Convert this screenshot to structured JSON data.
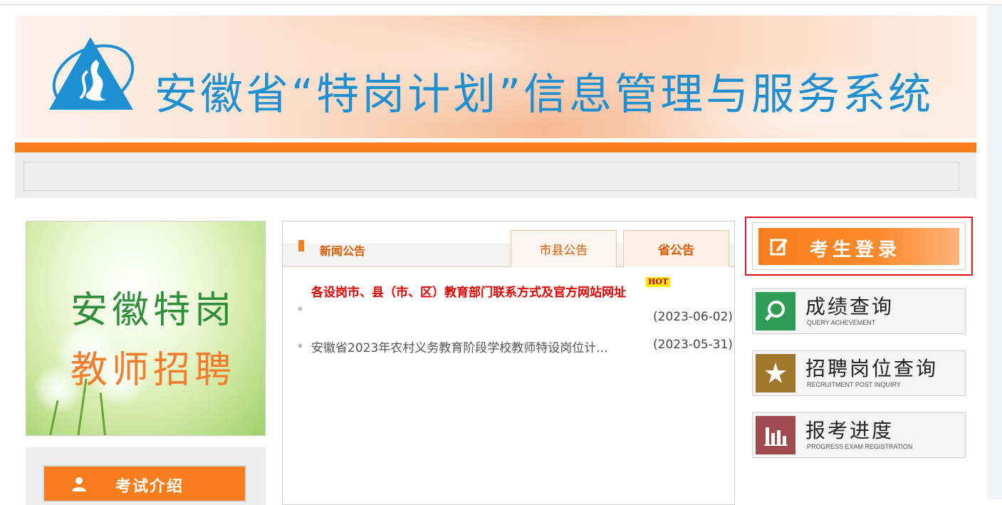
{
  "header": {
    "title": "安徽省“特岗计划”信息管理与服务系统"
  },
  "left": {
    "promo_line1": "安徽特岗",
    "promo_line2": "教师招聘",
    "exam_intro_label": "考试介绍"
  },
  "news": {
    "section_title": "新闻公告",
    "tabs": [
      {
        "label": "市县公告",
        "active": false
      },
      {
        "label": "省公告",
        "active": true
      }
    ],
    "hot_badge": "HOT",
    "items": [
      {
        "title": "各设岗市、县（市、区）教育部门联系方式及官方网站网址",
        "date": "(2023-06-02)",
        "hot": true
      },
      {
        "title": "安徽省2023年农村义务教育阶段学校教师特设岗位计...",
        "date": "(2023-05-31)",
        "hot": false
      }
    ]
  },
  "right": {
    "login_label": "考生登录",
    "buttons": [
      {
        "zh": "成绩查询",
        "en": "QUERY ACHEVEMENT",
        "icon": "search-icon",
        "color": "#2e9d55"
      },
      {
        "zh": "招聘岗位查询",
        "en": "RECRUITMENT POST INQUIRY",
        "icon": "star-icon",
        "color": "#a0782c"
      },
      {
        "zh": "报考进度",
        "en": "PROGRESS EXAM REGISTRATION",
        "icon": "bar-chart-icon",
        "color": "#9e4a4e"
      }
    ]
  },
  "colors": {
    "accent_orange": "#f97d1c",
    "title_blue": "#1e8fd0",
    "hot_red": "#e00000",
    "highlight_red": "#e0141c"
  }
}
